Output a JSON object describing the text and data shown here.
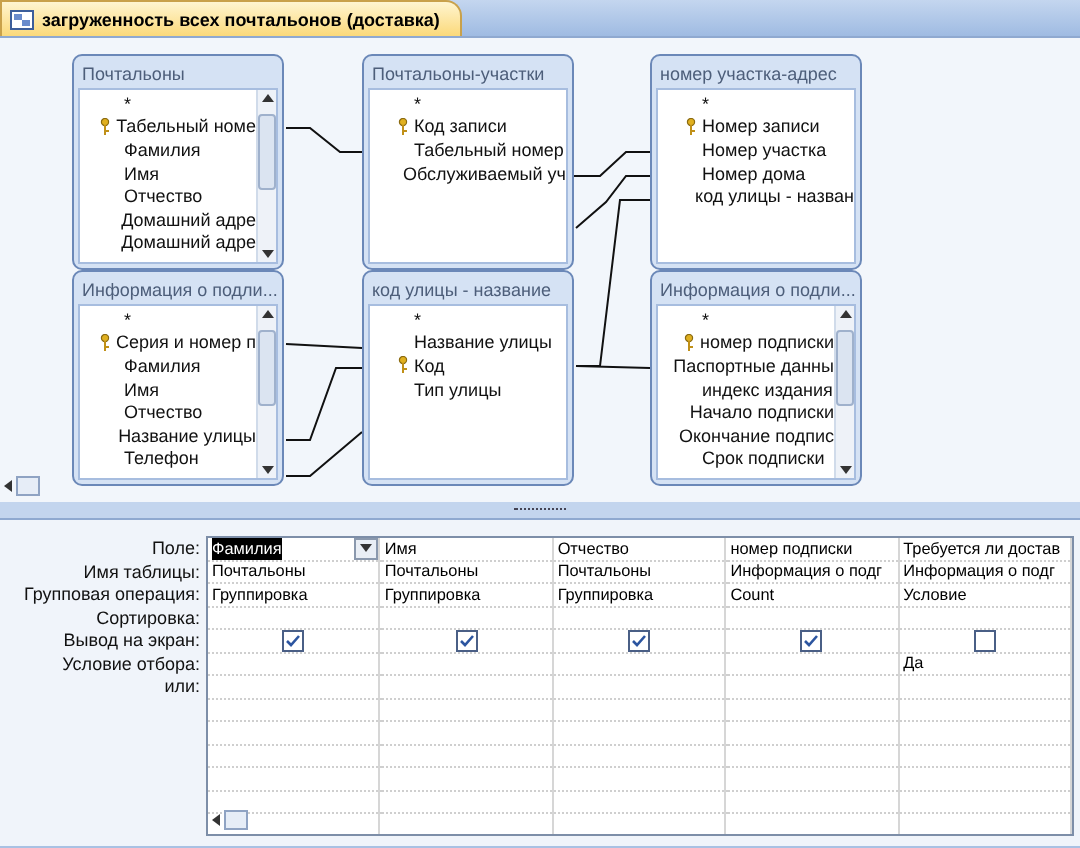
{
  "tab": {
    "title": "загруженность всех почтальонов (доставка)",
    "selected": true
  },
  "tables": [
    {
      "title": "Почтальоны",
      "fields": [
        {
          "name": "*",
          "key": false
        },
        {
          "name": "Табельный номе",
          "key": true
        },
        {
          "name": "Фамилия",
          "key": false
        },
        {
          "name": "Имя",
          "key": false
        },
        {
          "name": "Отчество",
          "key": false
        },
        {
          "name": "Домашний адре",
          "key": false
        },
        {
          "name": "Домашний адре",
          "key": false
        }
      ]
    },
    {
      "title": "Почтальоны-участки",
      "fields": [
        {
          "name": "*",
          "key": false
        },
        {
          "name": "Код записи",
          "key": true
        },
        {
          "name": "Табельный номер",
          "key": false
        },
        {
          "name": "Обслуживаемый уч",
          "key": false
        }
      ]
    },
    {
      "title": "номер участка-адрес",
      "fields": [
        {
          "name": "*",
          "key": false
        },
        {
          "name": "Номер записи",
          "key": true
        },
        {
          "name": "Номер участка",
          "key": false
        },
        {
          "name": "Номер дома",
          "key": false
        },
        {
          "name": "код улицы - назван",
          "key": false
        }
      ]
    },
    {
      "title": "Информация о подли...",
      "fields": [
        {
          "name": "*",
          "key": false
        },
        {
          "name": "Серия и номер п",
          "key": true
        },
        {
          "name": "Фамилия",
          "key": false
        },
        {
          "name": "Имя",
          "key": false
        },
        {
          "name": "Отчество",
          "key": false
        },
        {
          "name": "Название улицы",
          "key": false
        },
        {
          "name": "Телефон",
          "key": false
        }
      ]
    },
    {
      "title": "код улицы - название",
      "fields": [
        {
          "name": "*",
          "key": false
        },
        {
          "name": "Название  улицы",
          "key": false
        },
        {
          "name": "Код",
          "key": true
        },
        {
          "name": "Тип улицы",
          "key": false
        }
      ]
    },
    {
      "title": "Информация о подли...",
      "fields": [
        {
          "name": "*",
          "key": false
        },
        {
          "name": "номер подписки",
          "key": true
        },
        {
          "name": "Паспортные данны",
          "key": false
        },
        {
          "name": "индекс издания",
          "key": false
        },
        {
          "name": "Начало подписки",
          "key": false
        },
        {
          "name": "Окончание подпис",
          "key": false
        },
        {
          "name": "Срок подписки",
          "key": false
        }
      ]
    }
  ],
  "grid": {
    "row_labels": [
      "Поле:",
      "Имя таблицы:",
      "Групповая операция:",
      "Сортировка:",
      "Вывод на экран:",
      "Условие отбора:",
      "или:"
    ],
    "columns": [
      {
        "field": "Фамилия",
        "selected": true,
        "table": "Почтальоны",
        "total": "Группировка",
        "show": true
      },
      {
        "field": "Имя",
        "selected": false,
        "table": "Почтальоны",
        "total": "Группировка",
        "show": true
      },
      {
        "field": "Отчество",
        "selected": false,
        "table": "Почтальоны",
        "total": "Группировка",
        "show": true
      },
      {
        "field": "номер подписки",
        "selected": false,
        "table": "Информация о подг",
        "total": "Count",
        "show": true
      },
      {
        "field": "Требуется ли достав",
        "selected": false,
        "table": "Информация о подг",
        "total": "Условие",
        "show": false,
        "criteria": "Да"
      }
    ]
  }
}
